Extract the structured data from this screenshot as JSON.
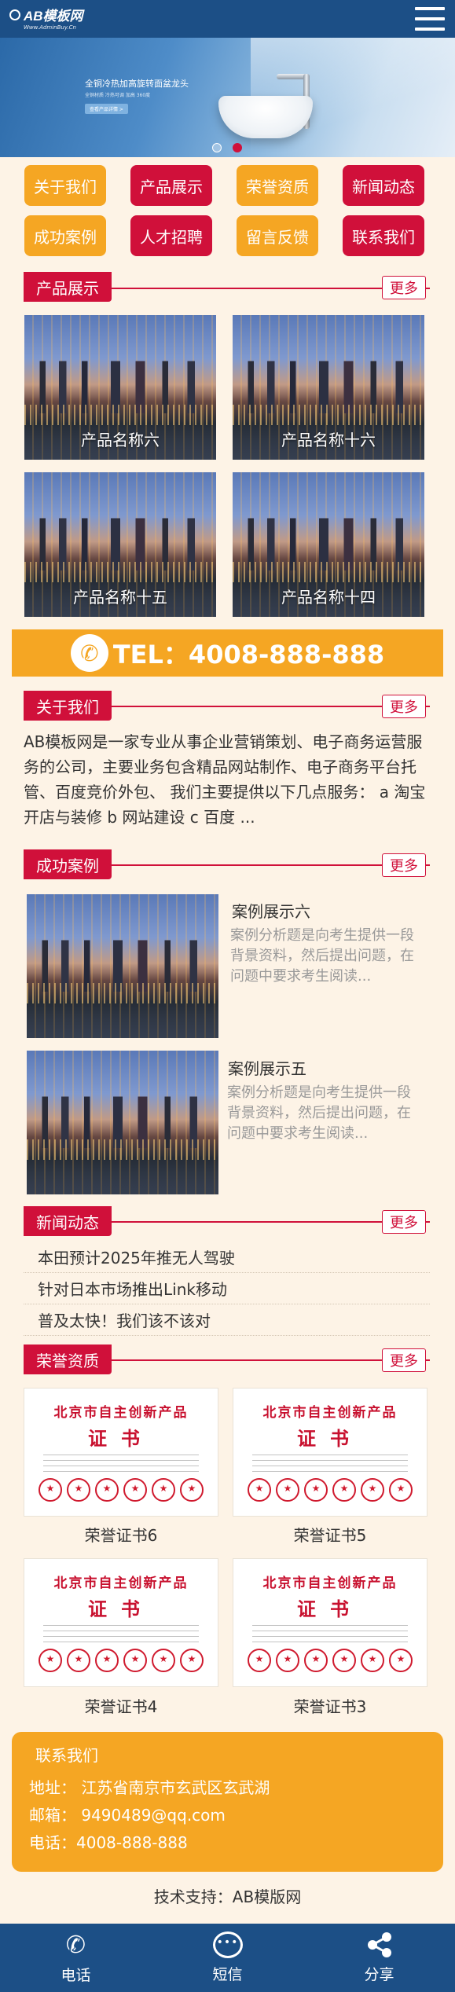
{
  "header": {
    "logo_text": "AB模板网",
    "logo_sub": "Www.AdminBuy.Cn"
  },
  "banner": {
    "title": "全铜冷热加高旋转面盆龙头",
    "subtitle": "全铜材质 冷热可调 加高 360度",
    "button": "查看产品详情 >"
  },
  "nav": [
    "关于我们",
    "产品展示",
    "荣誉资质",
    "新闻动态",
    "成功案例",
    "人才招聘",
    "留言反馈",
    "联系我们"
  ],
  "sections": {
    "products": "产品展示",
    "about": "关于我们",
    "cases": "成功案例",
    "news": "新闻动态",
    "honors": "荣誉资质",
    "more": "更多"
  },
  "products": [
    "产品名称六",
    "产品名称十六",
    "产品名称十五",
    "产品名称十四"
  ],
  "phone": "TEL：4008-888-888",
  "about_text": "AB模板网是一家专业从事企业营销策划、电子商务运营服务的公司，主要业务包含精品网站制作、电子商务平台托管、百度竞价外包、 我们主要提供以下几点服务： a 淘宝开店与装修 b 网站建设 c 百度 ...",
  "cases": [
    {
      "title": "案例展示六",
      "desc": "案例分析题是向考生提供一段背景资料，然后提出问题，在问题中要求考生阅读..."
    },
    {
      "title": "案例展示五",
      "desc": "案例分析题是向考生提供一段背景资料，然后提出问题，在问题中要求考生阅读..."
    }
  ],
  "news": [
    "本田预计2025年推无人驾驶",
    "针对日本市场推出Link移动",
    "普及太快！我们该不该对"
  ],
  "certificates": {
    "heading": "北京市自主创新产品",
    "subheading": "证书",
    "items": [
      "荣誉证书6",
      "荣誉证书5",
      "荣誉证书4",
      "荣誉证书3"
    ]
  },
  "contact": {
    "title": "联系我们",
    "address": "地址：  江苏省南京市玄武区玄武湖",
    "email": "邮箱：  9490489@qq.com",
    "phone": "电话：4008-888-888"
  },
  "support": "技术支持：AB模版网",
  "footer": [
    "电话",
    "短信",
    "分享"
  ],
  "colors": {
    "primary": "#1c4f86",
    "red": "#d0103a",
    "orange": "#f5a623",
    "background": "#fdf3e6"
  }
}
